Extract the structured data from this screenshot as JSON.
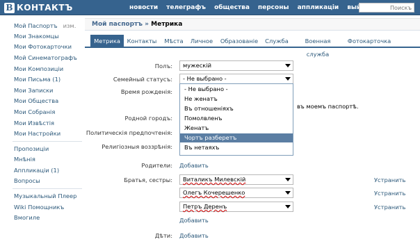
{
  "brand": {
    "logo_letter": "В",
    "logo_text": "контактъ"
  },
  "topnav": [
    "новости",
    "телеграфъ",
    "общества",
    "персоны",
    "аппликацiи",
    "выйти"
  ],
  "search": {
    "placeholder": "Поискъ"
  },
  "sidebar": {
    "group1": [
      {
        "label": "Мой Паспортъ",
        "extra": "изм."
      },
      {
        "label": "Мои Знакомцы"
      },
      {
        "label": "Мои Фотокарточки"
      },
      {
        "label": "Мой Синематографъ"
      },
      {
        "label": "Мои Композицiи"
      },
      {
        "label": "Мои Письма (1)"
      },
      {
        "label": "Мои Записки"
      },
      {
        "label": "Мои Общества"
      },
      {
        "label": "Мои Собранiя"
      },
      {
        "label": "Мои Извѣстiя"
      },
      {
        "label": "Мои Настройки"
      }
    ],
    "group2": [
      {
        "label": "Пропозицiи"
      },
      {
        "label": "Мнѣнiя"
      },
      {
        "label": "Аппликацiи (1)"
      },
      {
        "label": "Вопросы"
      }
    ],
    "group3": [
      {
        "label": "Музыкальный Плеер"
      },
      {
        "label": "Wiki Помощникъ"
      },
      {
        "label": "Вмогиле"
      }
    ]
  },
  "breadcrumb": {
    "parent": "Мой паспортъ",
    "separator": "»",
    "current": "Метрика"
  },
  "tabs": [
    "Метрика",
    "Контакты",
    "Мѣста",
    "Личное",
    "Образованiе",
    "Служба",
    "Военная служба",
    "Фотокарточка"
  ],
  "form": {
    "pol_label": "Полъ:",
    "pol_value": "мужескiй",
    "status_label": "Семейный статусъ:",
    "status_value": "- Не выбрано -",
    "birth_label": "Время рожденiя:",
    "birth_hint": "въ моемъ паспортѣ.",
    "city_label": "Родной городъ:",
    "politic_label": "Политическiя предпочтенiя:",
    "religion_label": "Религiозныя воззрѣнiя:",
    "parents_label": "Родители:",
    "siblings_label": "Братья, сестры:",
    "siblings": [
      "Виталикъ Милевскiй",
      "Олегъ Кочерешенко",
      "Петръ Деренъ"
    ],
    "remove_label": "Устранить",
    "add_label": "Добавить",
    "children_label": "Дѣти:"
  },
  "status_dropdown": {
    "options": [
      "- Не выбрано -",
      "Не женатъ",
      "Въ отношенiяхъ",
      "Помолвленъ",
      "Женатъ",
      "Чортъ разберетъ",
      "Въ нетаяхъ"
    ],
    "highlighted_index": 5
  }
}
